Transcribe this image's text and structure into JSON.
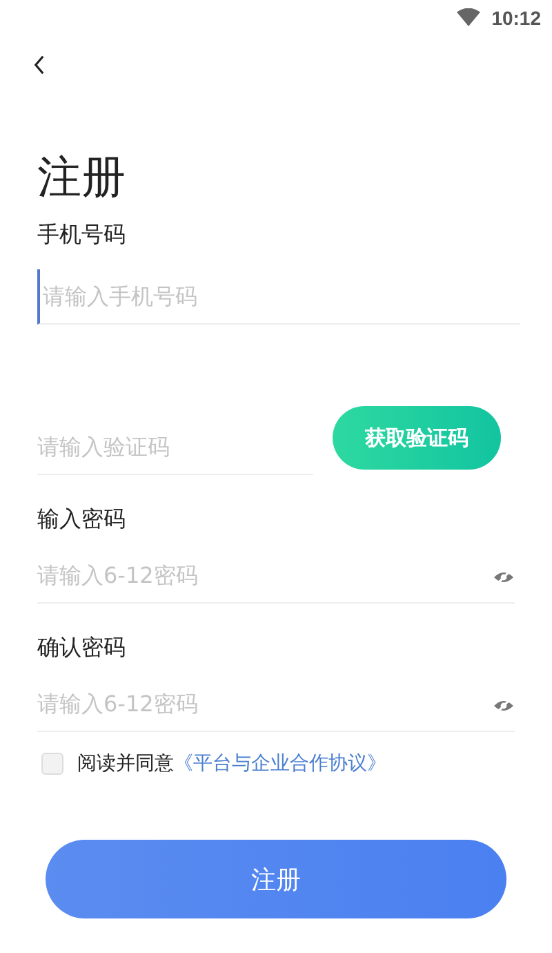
{
  "status_bar": {
    "time": "10:12"
  },
  "title": "注册",
  "phone": {
    "label": "手机号码",
    "placeholder": "请输入手机号码"
  },
  "code": {
    "placeholder": "请输入验证码",
    "button": "获取验证码"
  },
  "password": {
    "label": "输入密码",
    "placeholder": "请输入6-12密码"
  },
  "confirm": {
    "label": "确认密码",
    "placeholder": "请输入6-12密码"
  },
  "agreement": {
    "checked": false,
    "text": "阅读并同意",
    "link": "《平台与企业合作协议》"
  },
  "submit": "注册"
}
